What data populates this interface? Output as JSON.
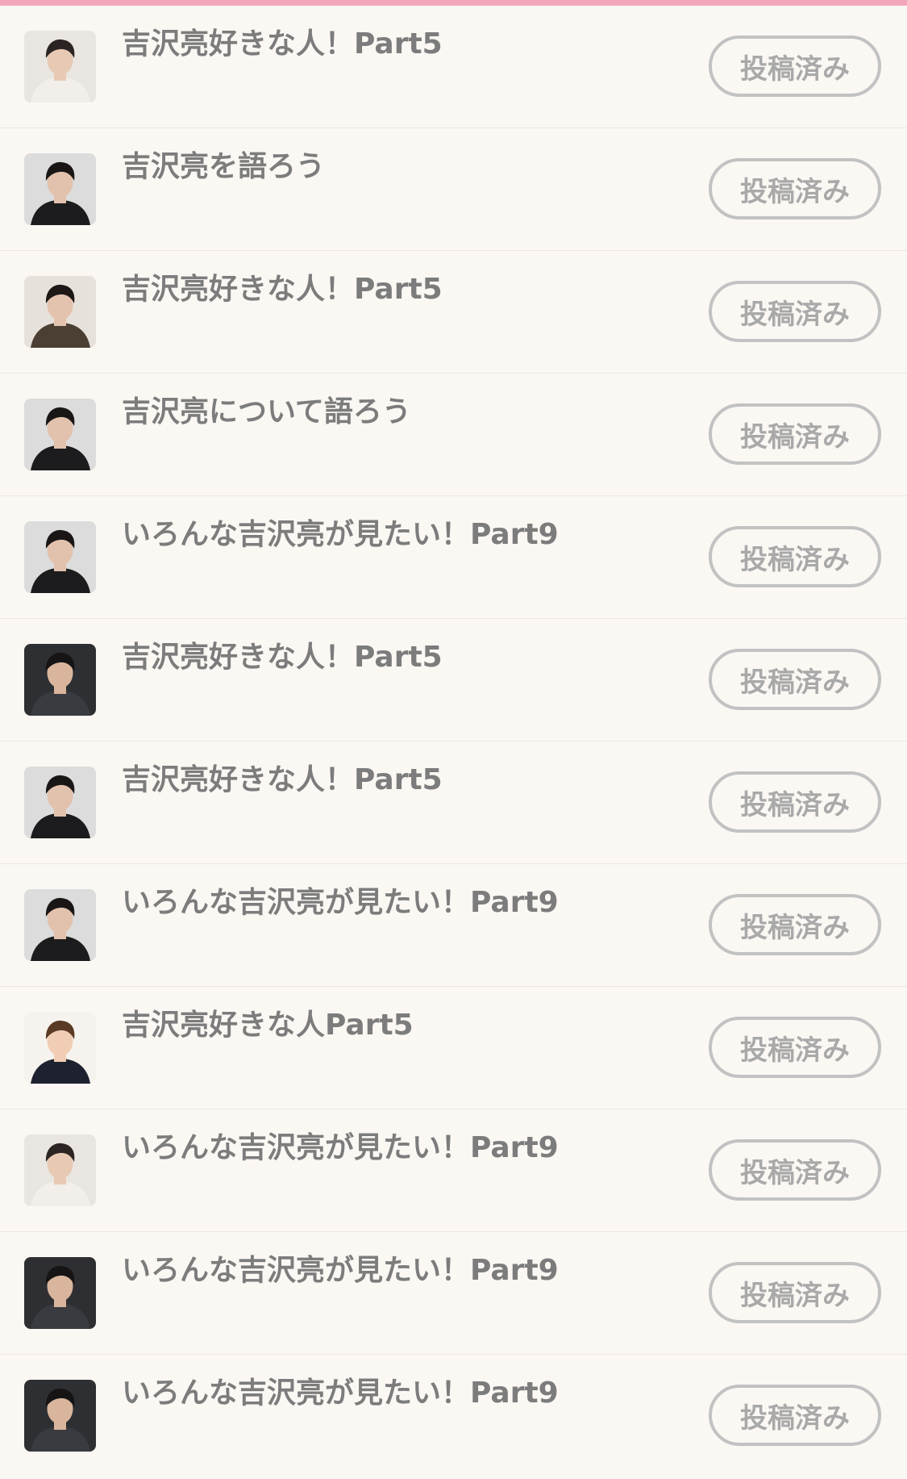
{
  "colors": {
    "top_bar": "#f2a6bb",
    "background": "#fbf7f3",
    "title_text": "#7c7c7c",
    "button_border": "#c2c2c2",
    "button_text": "#a9a9a9"
  },
  "threads": [
    {
      "title": "吉沢亮好きな人！Part5",
      "button_label": "投稿済み",
      "thumb": "light"
    },
    {
      "title": "吉沢亮を語ろう",
      "button_label": "投稿済み",
      "thumb": "dark"
    },
    {
      "title": "吉沢亮好きな人！Part5",
      "button_label": "投稿済み",
      "thumb": "brown"
    },
    {
      "title": "吉沢亮について語ろう",
      "button_label": "投稿済み",
      "thumb": "dark"
    },
    {
      "title": "いろんな吉沢亮が見たい！Part9",
      "button_label": "投稿済み",
      "thumb": "dark"
    },
    {
      "title": "吉沢亮好きな人！Part5",
      "button_label": "投稿済み",
      "thumb": "magazine"
    },
    {
      "title": "吉沢亮好きな人！Part5",
      "button_label": "投稿済み",
      "thumb": "dark"
    },
    {
      "title": "いろんな吉沢亮が見たい！Part9",
      "button_label": "投稿済み",
      "thumb": "dark"
    },
    {
      "title": "吉沢亮好きな人Part5",
      "button_label": "投稿済み",
      "thumb": "bright"
    },
    {
      "title": "いろんな吉沢亮が見たい！Part9",
      "button_label": "投稿済み",
      "thumb": "light"
    },
    {
      "title": "いろんな吉沢亮が見たい！Part9",
      "button_label": "投稿済み",
      "thumb": "magazine"
    },
    {
      "title": "いろんな吉沢亮が見たい！Part9",
      "button_label": "投稿済み",
      "thumb": "magazine"
    }
  ]
}
